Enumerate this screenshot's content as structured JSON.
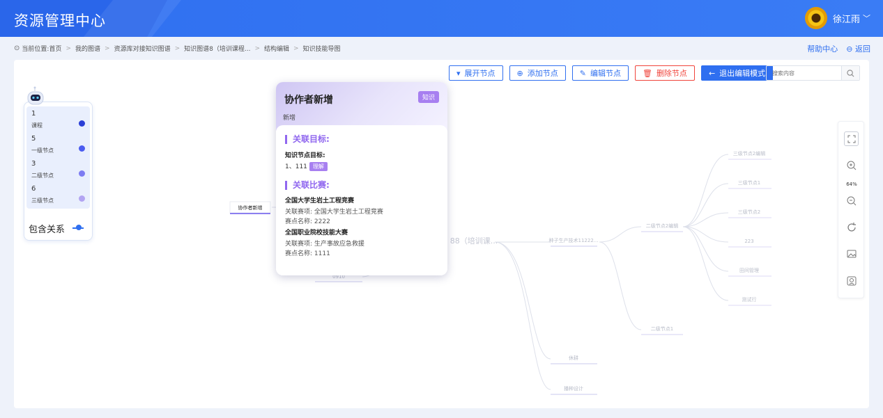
{
  "header": {
    "app_title": "资源管理中心",
    "user_name": "徐江雨",
    "user_chevron": "﹀"
  },
  "breadcrumb": {
    "prefix": "当前位置:",
    "items": [
      "首页",
      "我的图谱",
      "资源库对接知识图谱",
      "知识图谱8（培训课程...",
      "结构编辑",
      "知识技能导图"
    ]
  },
  "top_links": {
    "help": "帮助中心",
    "back": "返回"
  },
  "toolbar": {
    "expand": "展开节点",
    "add": "添加节点",
    "edit": "编辑节点",
    "delete": "删除节点",
    "exit": "退出编辑模式"
  },
  "search": {
    "placeholder": "搜索内容"
  },
  "legend": {
    "items": [
      {
        "count": "1",
        "label": "课程",
        "color": "#2a3fd6"
      },
      {
        "count": "5",
        "label": "一级节点",
        "color": "#4b5cf0"
      },
      {
        "count": "3",
        "label": "二级节点",
        "color": "#7d7cf2"
      },
      {
        "count": "6",
        "label": "三级节点",
        "color": "#b2a4f2"
      }
    ],
    "relation_label": "包含关系"
  },
  "map": {
    "selected_node": "协作者新增",
    "root_node": "88（培训课...",
    "nodes": {
      "n_left_below": "0910",
      "n_main": "种子生产技术11222...",
      "n_level2_edit": "二级节点2编辑",
      "n_level2_1": "二级节点1",
      "n_fallow": "休耕",
      "n_mechanical": "播种设计",
      "n_l3_2edit": "三级节点2编辑",
      "n_l3_1": "三级节点1",
      "n_l3_2": "三级节点2",
      "n_223": "223",
      "n_water": "田间管理",
      "n_test": "测试行"
    }
  },
  "card": {
    "title": "协作者新增",
    "tag": "知识",
    "subtitle": "新增",
    "target_heading": "关联目标:",
    "target_label": "知识节点目标:",
    "target_item": "1、111",
    "target_tag": "理解",
    "comp_heading": "关联比赛:",
    "comps": [
      {
        "name": "全国大学生岩土工程竞赛",
        "item_label": "关联赛项:",
        "item_value": "全国大学生岩土工程竞赛",
        "point_label": "赛点名称:",
        "point_value": "2222"
      },
      {
        "name": "全国职业院校技能大赛",
        "item_label": "关联赛项:",
        "item_value": "生产事故应急救援",
        "point_label": "赛点名称:",
        "point_value": "1111"
      }
    ]
  },
  "tools": {
    "zoom_level": "64%"
  },
  "colors": {
    "primary": "#2f6ff0",
    "danger": "#f0443b",
    "accent_purple": "#9067ef",
    "header_bg": "#3a7cf5"
  }
}
